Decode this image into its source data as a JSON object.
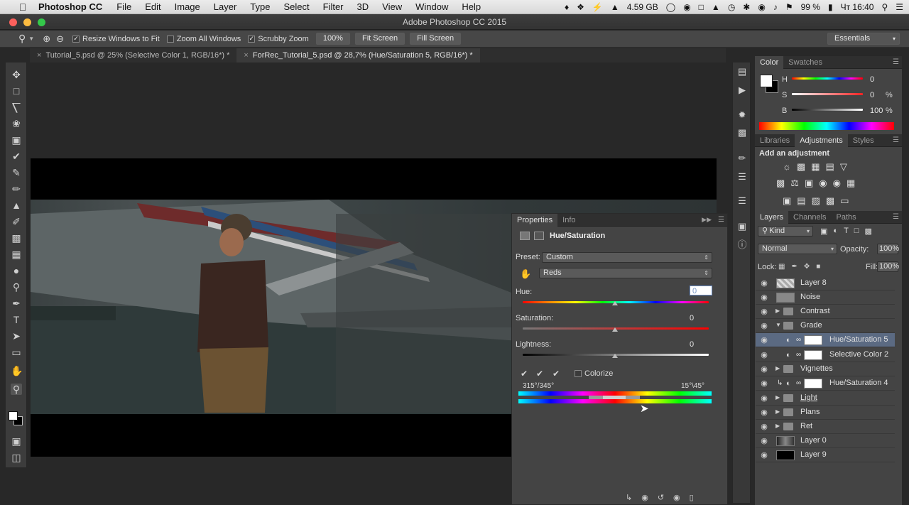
{
  "menubar": {
    "app": "Photoshop CC",
    "items": [
      "File",
      "Edit",
      "Image",
      "Layer",
      "Type",
      "Select",
      "Filter",
      "3D",
      "View",
      "Window",
      "Help"
    ],
    "memory": "4.59 GB",
    "battery": "99 %",
    "clock": "Чт 16:40"
  },
  "window": {
    "title": "Adobe Photoshop CC 2015"
  },
  "options": {
    "resize": "Resize Windows to Fit",
    "zoom_all": "Zoom All Windows",
    "scrubby": "Scrubby Zoom",
    "pct": "100%",
    "fit": "Fit Screen",
    "fill": "Fill Screen",
    "workspace": "Essentials"
  },
  "tabs": [
    {
      "label": "Tutorial_5.psd @ 25% (Selective Color 1, RGB/16*) *"
    },
    {
      "label": "ForRec_Tutorial_5.psd @ 28,7% (Hue/Saturation 5, RGB/16*) *"
    }
  ],
  "color_panel": {
    "tabs": [
      "Color",
      "Swatches"
    ],
    "h_label": "H",
    "s_label": "S",
    "b_label": "B",
    "h": "0",
    "s": "0",
    "b": "100",
    "pct": "%"
  },
  "adj_panel": {
    "tabs": [
      "Libraries",
      "Adjustments",
      "Styles"
    ],
    "heading": "Add an adjustment"
  },
  "properties": {
    "tabs": [
      "Properties",
      "Info"
    ],
    "title": "Hue/Saturation",
    "preset_label": "Preset:",
    "preset_value": "Custom",
    "channel": "Reds",
    "hue_label": "Hue:",
    "hue": "0",
    "sat_label": "Saturation:",
    "sat": "0",
    "light_label": "Lightness:",
    "light": "0",
    "colorize": "Colorize",
    "range_left": "315°/345°",
    "range_right": "15°\\45°"
  },
  "layers_panel": {
    "tabs": [
      "Layers",
      "Channels",
      "Paths"
    ],
    "filter": "Kind",
    "blend": "Normal",
    "opacity_label": "Opacity:",
    "opacity": "100%",
    "lock_label": "Lock:",
    "fill_label": "Fill:",
    "fill": "100%"
  },
  "layers": [
    {
      "name": "Layer 8"
    },
    {
      "name": "Noise"
    },
    {
      "name": "Contrast"
    },
    {
      "name": "Grade"
    },
    {
      "name": "Hue/Saturation 5"
    },
    {
      "name": "Selective Color 2"
    },
    {
      "name": "Vignettes"
    },
    {
      "name": "Hue/Saturation 4"
    },
    {
      "name": "Light"
    },
    {
      "name": "Plans"
    },
    {
      "name": "Ret"
    },
    {
      "name": "Layer 0"
    },
    {
      "name": "Layer 9"
    }
  ],
  "colors": {
    "selected_layer": "#5b6a82",
    "panel": "#444444"
  }
}
